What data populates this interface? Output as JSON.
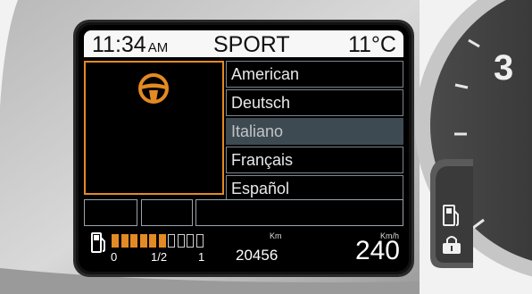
{
  "status_bar": {
    "time": "11:34",
    "ampm": "AM",
    "drive_mode": "SPORT",
    "temperature": "11°C"
  },
  "left_panel": {
    "icon": "steering-wheel-icon",
    "accent": "#e38a23"
  },
  "language_menu": {
    "items": [
      {
        "label": "American",
        "selected": false
      },
      {
        "label": "Deutsch",
        "selected": false
      },
      {
        "label": "Italiano",
        "selected": true
      },
      {
        "label": "Français",
        "selected": false
      },
      {
        "label": "Español",
        "selected": false
      }
    ]
  },
  "fuel": {
    "icon": "fuel-pump-icon",
    "level_fraction": 0.6,
    "segments_total": 10,
    "segments_filled": 6,
    "tick_labels": [
      "0",
      "1/2",
      "1"
    ]
  },
  "odometer": {
    "unit": "Km",
    "value": "20456"
  },
  "speed": {
    "unit": "Km/h",
    "value": "240"
  },
  "gauge": {
    "visible_number": "3"
  },
  "side_indicators": {
    "icons": [
      "fuel-pump-icon",
      "fuel-cap-lock-icon"
    ]
  },
  "colors": {
    "accent": "#e38a23",
    "highlight": "#3e4a52",
    "background": "#000000"
  }
}
